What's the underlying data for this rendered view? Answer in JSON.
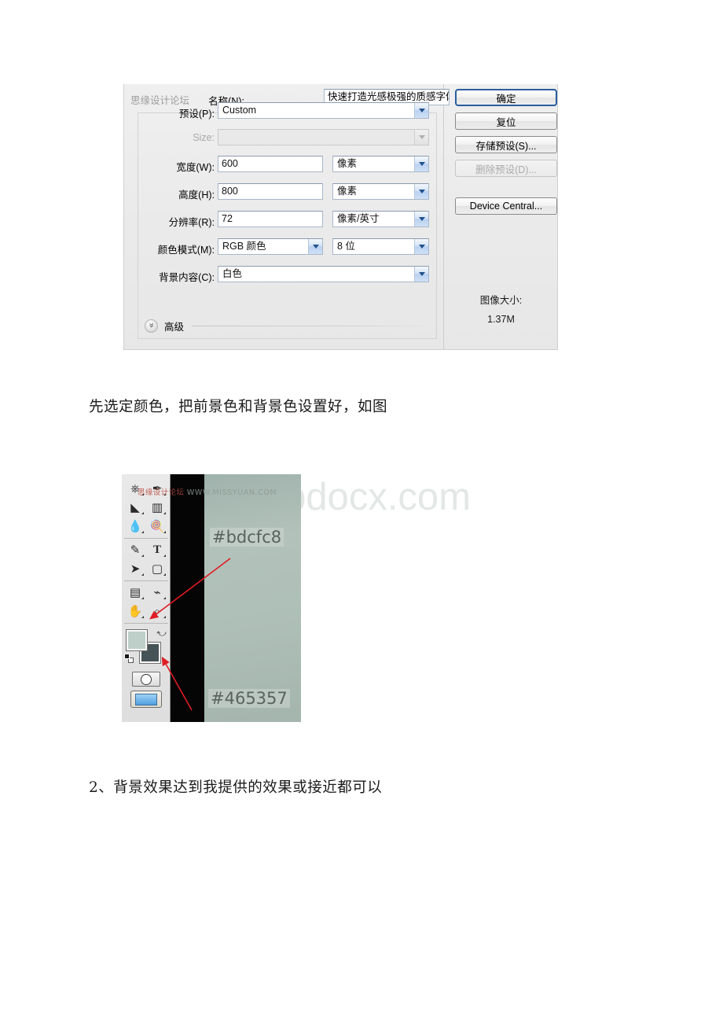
{
  "page": {
    "watermark_text": "www.bdocx.com"
  },
  "dialog": {
    "forum_watermark": "思缘设计论坛",
    "name_label": "名称(N):",
    "name_value": "快速打造光感极强的质感字体",
    "preset_label": "预设(P):",
    "preset_value": "Custom",
    "size_label": "Size:",
    "size_value": "",
    "width_label": "宽度(W):",
    "width_value": "600",
    "width_unit": "像素",
    "height_label": "高度(H):",
    "height_value": "800",
    "height_unit": "像素",
    "resolution_label": "分辨率(R):",
    "resolution_value": "72",
    "resolution_unit": "像素/英寸",
    "colormode_label": "颜色模式(M):",
    "colormode_value": "RGB 颜色",
    "colordepth_value": "8 位",
    "background_label": "背景内容(C):",
    "background_value": "白色",
    "advanced_label": "高级",
    "buttons": {
      "ok": "确定",
      "reset": "复位",
      "save_preset": "存储预设(S)...",
      "delete_preset": "删除预设(D)...",
      "device_central": "Device Central..."
    },
    "image_size_label": "图像大小:",
    "image_size_value": "1.37M"
  },
  "paragraphs": {
    "first": "先选定颜色，把前景色和背景色设置好，如图",
    "second": "2、背景效果达到我提供的效果或接近都可以"
  },
  "ps_screenshot": {
    "forum_watermark": "思缘设计论坛",
    "site_watermark": "WWW.MISSYUAN.COM",
    "foreground_hex": "#bdcfc8",
    "background_hex": "#465357",
    "toolbar_icons": [
      "stamp-tool-icon",
      "history-brush-tool-icon",
      "eraser-tool-icon",
      "gradient-tool-icon",
      "blur-tool-icon",
      "dodge-tool-icon",
      "pen-tool-icon",
      "type-tool-icon",
      "path-selection-tool-icon",
      "shape-tool-icon",
      "notes-tool-icon",
      "eyedropper-tool-icon",
      "hand-tool-icon",
      "zoom-tool-icon"
    ],
    "toolbar_glyphs": [
      "⎙",
      "✎",
      "◣",
      "▤",
      "◍",
      "◉",
      "✒",
      "T",
      "➤",
      "▢",
      "▤",
      "⌁",
      "✋",
      "⌕"
    ]
  }
}
